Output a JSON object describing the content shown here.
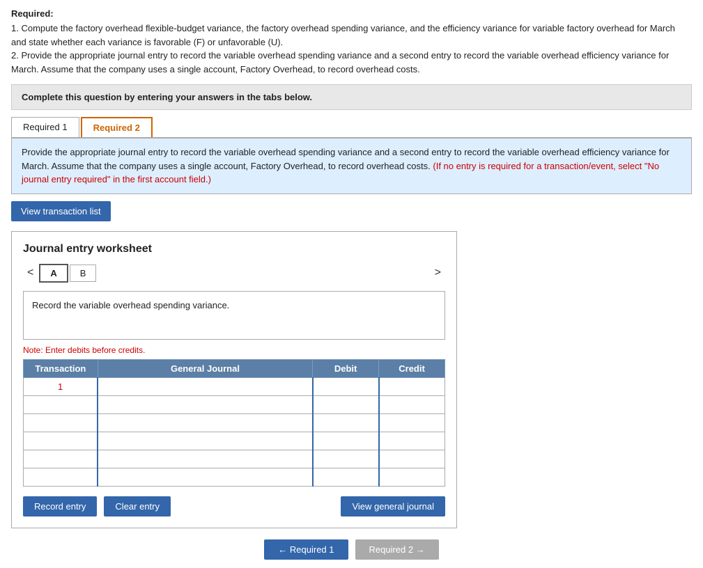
{
  "required_header": "Required:",
  "instructions": {
    "line1": "1. Compute the factory overhead flexible-budget variance, the factory overhead spending variance, and the efficiency variance for variable factory overhead for March and state whether each variance is favorable (F) or unfavorable (U).",
    "line2": "2. Provide the appropriate journal entry to record the variable overhead spending variance and a second entry to record the variable overhead efficiency variance for March. Assume that the company uses a single account, Factory Overhead, to record overhead costs."
  },
  "complete_box": "Complete this question by entering your answers in the tabs below.",
  "tabs": [
    {
      "label": "Required 1",
      "active": false
    },
    {
      "label": "Required 2",
      "active": true
    }
  ],
  "tab_content": {
    "line1": "Provide the appropriate journal entry to record the variable overhead spending variance and a second entry to record the variable overhead efficiency variance for March. Assume that the company uses a single account, Factory Overhead, to record overhead costs.",
    "line2": "(If no entry is required for a transaction/event, select \"No journal entry required\" in the first account field.)"
  },
  "view_transaction_btn": "View transaction list",
  "worksheet": {
    "title": "Journal entry worksheet",
    "tabs": [
      {
        "label": "A",
        "active": true
      },
      {
        "label": "B",
        "active": false
      }
    ],
    "description": "Record the variable overhead spending variance.",
    "note": "Note: Enter debits before credits.",
    "table": {
      "headers": [
        "Transaction",
        "General Journal",
        "Debit",
        "Credit"
      ],
      "rows": [
        {
          "transaction": "1",
          "general_journal": "",
          "debit": "",
          "credit": ""
        },
        {
          "transaction": "",
          "general_journal": "",
          "debit": "",
          "credit": ""
        },
        {
          "transaction": "",
          "general_journal": "",
          "debit": "",
          "credit": ""
        },
        {
          "transaction": "",
          "general_journal": "",
          "debit": "",
          "credit": ""
        },
        {
          "transaction": "",
          "general_journal": "",
          "debit": "",
          "credit": ""
        },
        {
          "transaction": "",
          "general_journal": "",
          "debit": "",
          "credit": ""
        }
      ]
    },
    "buttons": {
      "record": "Record entry",
      "clear": "Clear entry",
      "view_journal": "View general journal"
    }
  },
  "bottom_nav": {
    "prev": "← Required 1",
    "next": "Required 2 →"
  }
}
